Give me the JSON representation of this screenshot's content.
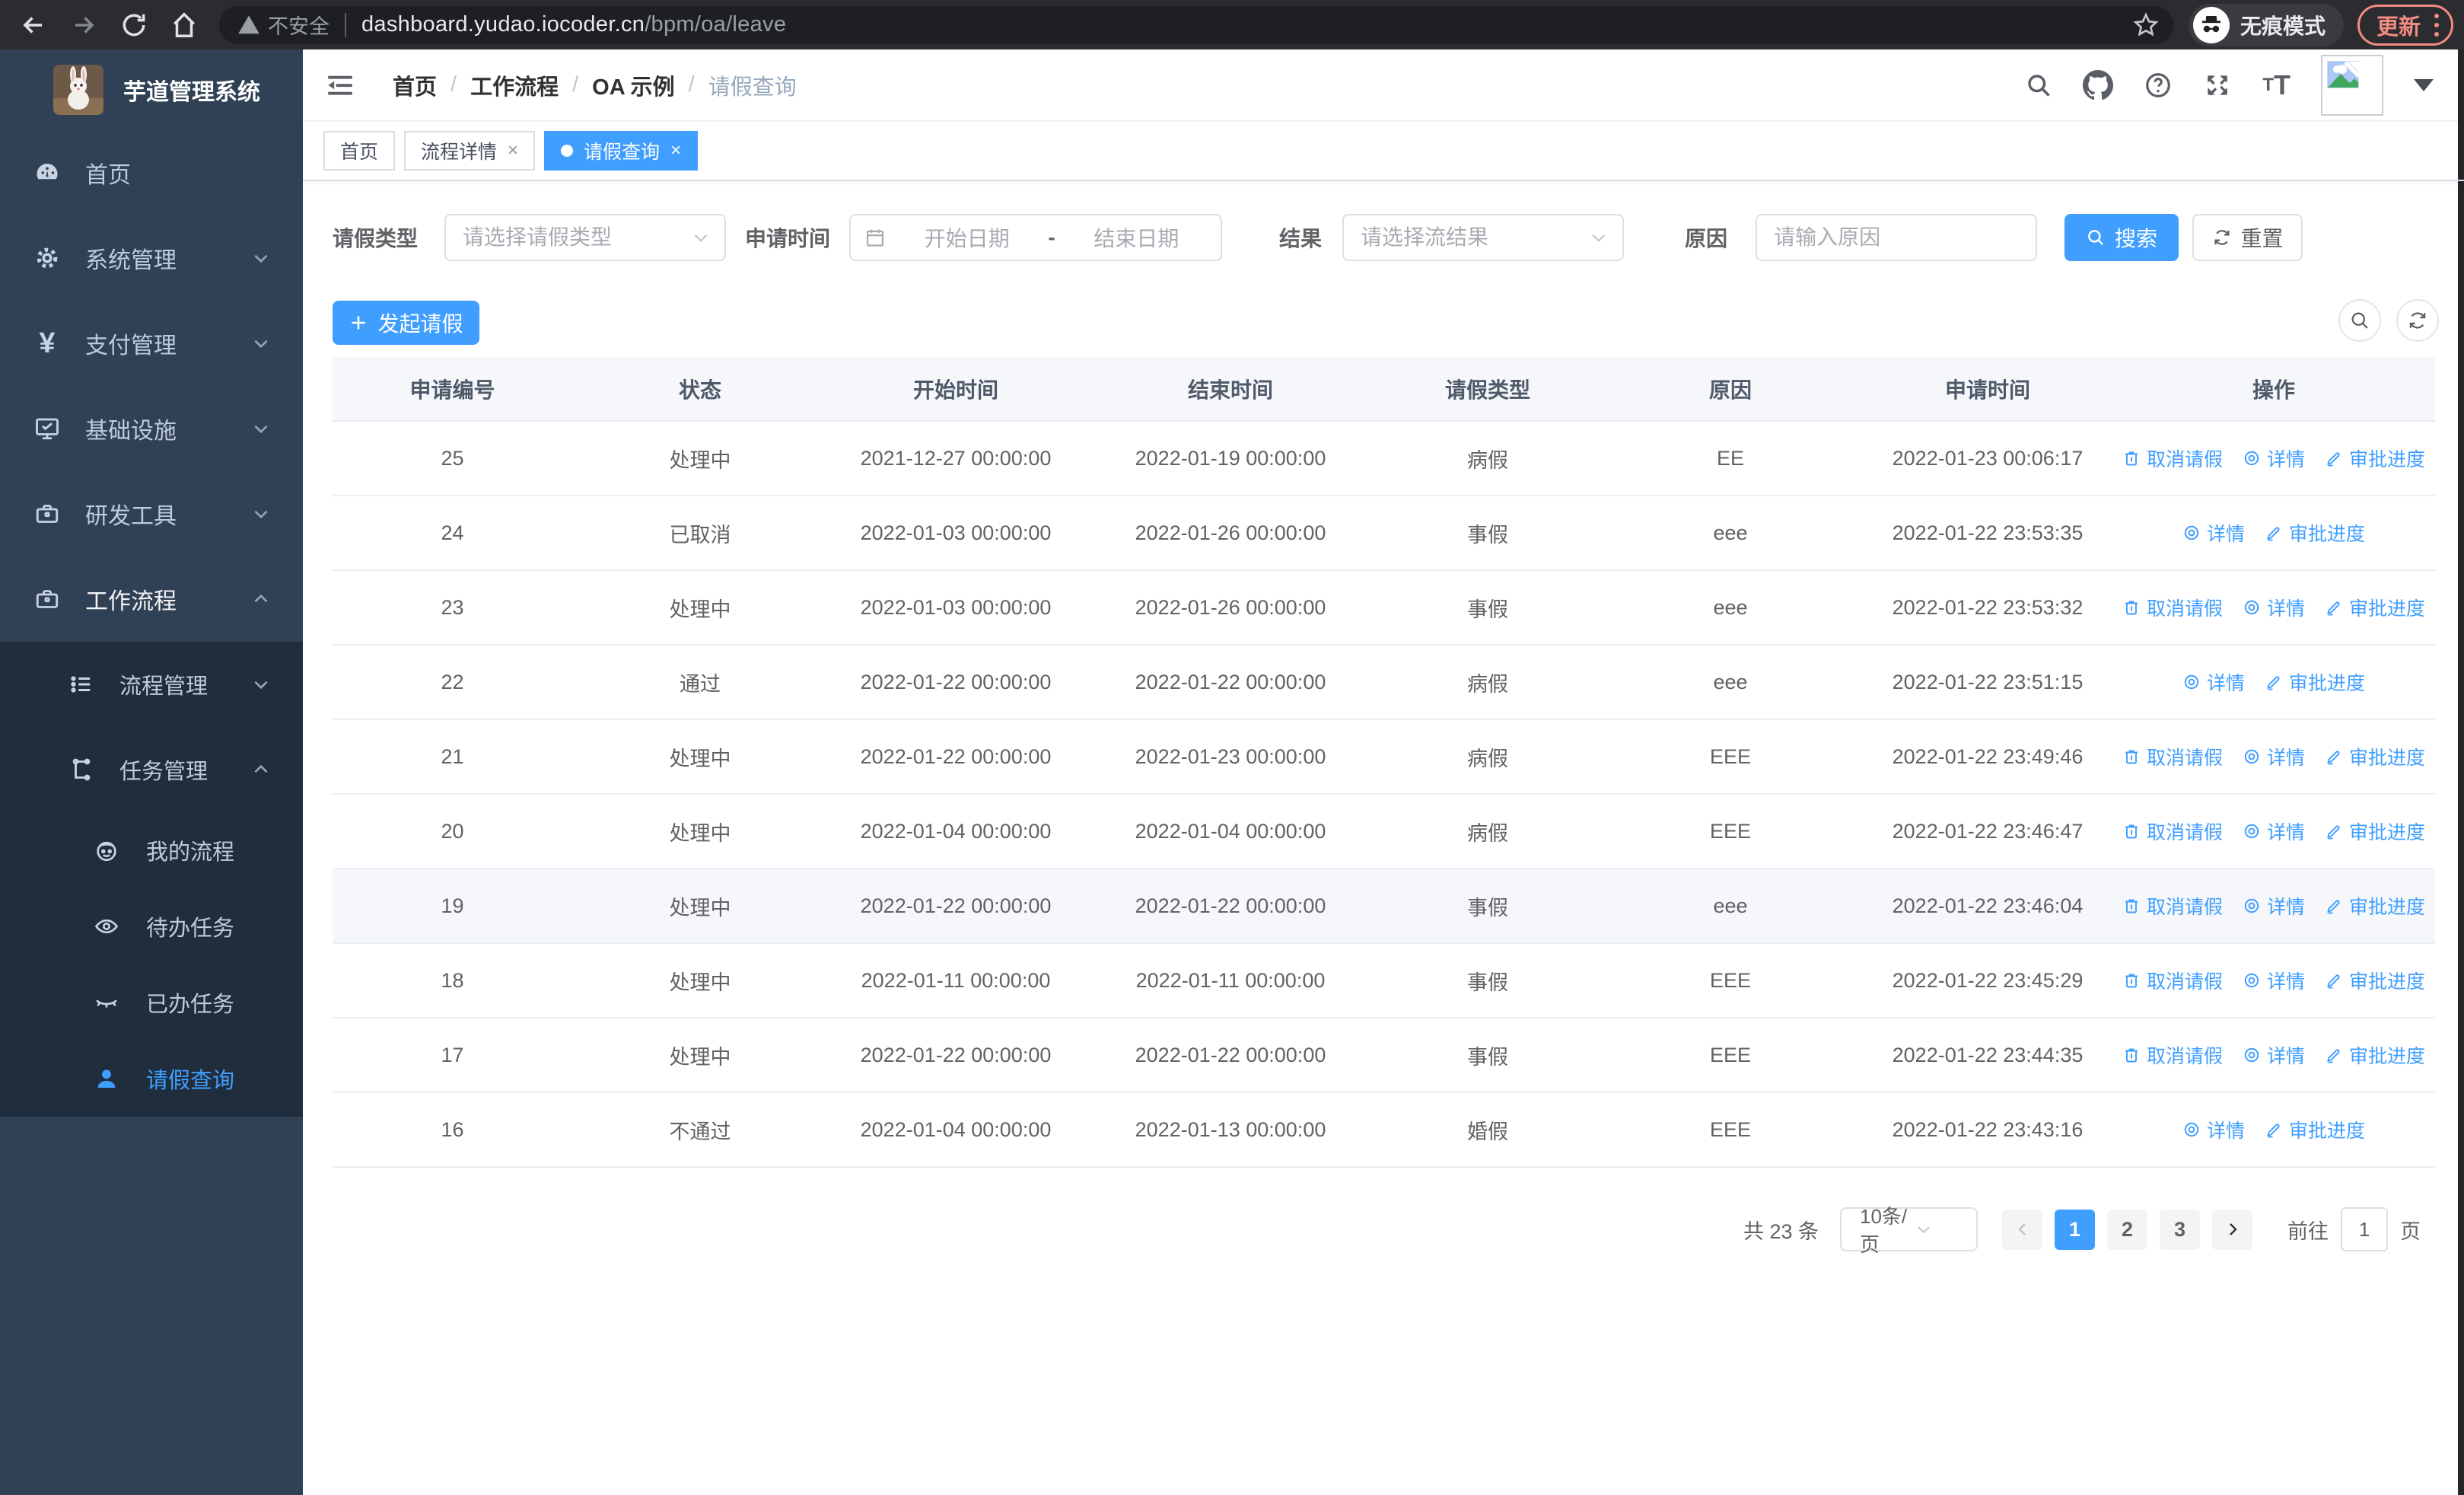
{
  "browser": {
    "security_label": "不安全",
    "url_host": "dashboard.yudao.iocoder.cn",
    "url_path": "/bpm/oa/leave",
    "incognito_label": "无痕模式",
    "update_label": "更新"
  },
  "sidebar": {
    "title": "芋道管理系统",
    "items": [
      {
        "label": "首页"
      },
      {
        "label": "系统管理"
      },
      {
        "label": "支付管理"
      },
      {
        "label": "基础设施"
      },
      {
        "label": "研发工具"
      },
      {
        "label": "工作流程",
        "expanded": true
      },
      {
        "label": "流程管理"
      },
      {
        "label": "任务管理",
        "expanded": true
      },
      {
        "label": "我的流程"
      },
      {
        "label": "待办任务"
      },
      {
        "label": "已办任务"
      },
      {
        "label": "请假查询",
        "active": true
      }
    ]
  },
  "breadcrumb": {
    "items": [
      "首页",
      "工作流程",
      "OA 示例",
      "请假查询"
    ],
    "separator": "/"
  },
  "tabs": [
    {
      "label": "首页",
      "closable": false,
      "active": false
    },
    {
      "label": "流程详情",
      "closable": true,
      "active": false
    },
    {
      "label": "请假查询",
      "closable": true,
      "active": true
    }
  ],
  "filters": {
    "leave_type_label": "请假类型",
    "leave_type_placeholder": "请选择请假类型",
    "apply_time_label": "申请时间",
    "start_placeholder": "开始日期",
    "range_separator": "-",
    "end_placeholder": "结束日期",
    "result_label": "结果",
    "result_placeholder": "请选择流结果",
    "reason_label": "原因",
    "reason_placeholder": "请输入原因",
    "search_label": "搜索",
    "reset_label": "重置"
  },
  "toolbar": {
    "create_label": "发起请假"
  },
  "table": {
    "columns": [
      "申请编号",
      "状态",
      "开始时间",
      "结束时间",
      "请假类型",
      "原因",
      "申请时间",
      "操作"
    ],
    "action_labels": {
      "cancel": "取消请假",
      "detail": "详情",
      "progress": "审批进度"
    },
    "rows": [
      {
        "id": "25",
        "status": "处理中",
        "start": "2021-12-27 00:00:00",
        "end": "2022-01-19 00:00:00",
        "type": "病假",
        "reason": "EE",
        "apply": "2022-01-23 00:06:17",
        "actions": [
          "cancel",
          "detail",
          "progress"
        ]
      },
      {
        "id": "24",
        "status": "已取消",
        "start": "2022-01-03 00:00:00",
        "end": "2022-01-26 00:00:00",
        "type": "事假",
        "reason": "eee",
        "apply": "2022-01-22 23:53:35",
        "actions": [
          "detail",
          "progress"
        ]
      },
      {
        "id": "23",
        "status": "处理中",
        "start": "2022-01-03 00:00:00",
        "end": "2022-01-26 00:00:00",
        "type": "事假",
        "reason": "eee",
        "apply": "2022-01-22 23:53:32",
        "actions": [
          "cancel",
          "detail",
          "progress"
        ]
      },
      {
        "id": "22",
        "status": "通过",
        "start": "2022-01-22 00:00:00",
        "end": "2022-01-22 00:00:00",
        "type": "病假",
        "reason": "eee",
        "apply": "2022-01-22 23:51:15",
        "actions": [
          "detail",
          "progress"
        ]
      },
      {
        "id": "21",
        "status": "处理中",
        "start": "2022-01-22 00:00:00",
        "end": "2022-01-23 00:00:00",
        "type": "病假",
        "reason": "EEE",
        "apply": "2022-01-22 23:49:46",
        "actions": [
          "cancel",
          "detail",
          "progress"
        ]
      },
      {
        "id": "20",
        "status": "处理中",
        "start": "2022-01-04 00:00:00",
        "end": "2022-01-04 00:00:00",
        "type": "病假",
        "reason": "EEE",
        "apply": "2022-01-22 23:46:47",
        "actions": [
          "cancel",
          "detail",
          "progress"
        ]
      },
      {
        "id": "19",
        "status": "处理中",
        "start": "2022-01-22 00:00:00",
        "end": "2022-01-22 00:00:00",
        "type": "事假",
        "reason": "eee",
        "apply": "2022-01-22 23:46:04",
        "actions": [
          "cancel",
          "detail",
          "progress"
        ],
        "highlighted": true
      },
      {
        "id": "18",
        "status": "处理中",
        "start": "2022-01-11 00:00:00",
        "end": "2022-01-11 00:00:00",
        "type": "事假",
        "reason": "EEE",
        "apply": "2022-01-22 23:45:29",
        "actions": [
          "cancel",
          "detail",
          "progress"
        ]
      },
      {
        "id": "17",
        "status": "处理中",
        "start": "2022-01-22 00:00:00",
        "end": "2022-01-22 00:00:00",
        "type": "事假",
        "reason": "EEE",
        "apply": "2022-01-22 23:44:35",
        "actions": [
          "cancel",
          "detail",
          "progress"
        ]
      },
      {
        "id": "16",
        "status": "不通过",
        "start": "2022-01-04 00:00:00",
        "end": "2022-01-13 00:00:00",
        "type": "婚假",
        "reason": "EEE",
        "apply": "2022-01-22 23:43:16",
        "actions": [
          "detail",
          "progress"
        ]
      }
    ]
  },
  "pagination": {
    "total": "共 23 条",
    "page_size": "10条/页",
    "pages": [
      "1",
      "2",
      "3"
    ],
    "active_page": "1",
    "goto_label": "前往",
    "goto_value": "1",
    "page_unit": "页"
  },
  "colors": {
    "accent": "#409eff",
    "sidebar_bg": "#304156",
    "submenu_bg": "#1f2d3d",
    "update": "#f28b82"
  }
}
